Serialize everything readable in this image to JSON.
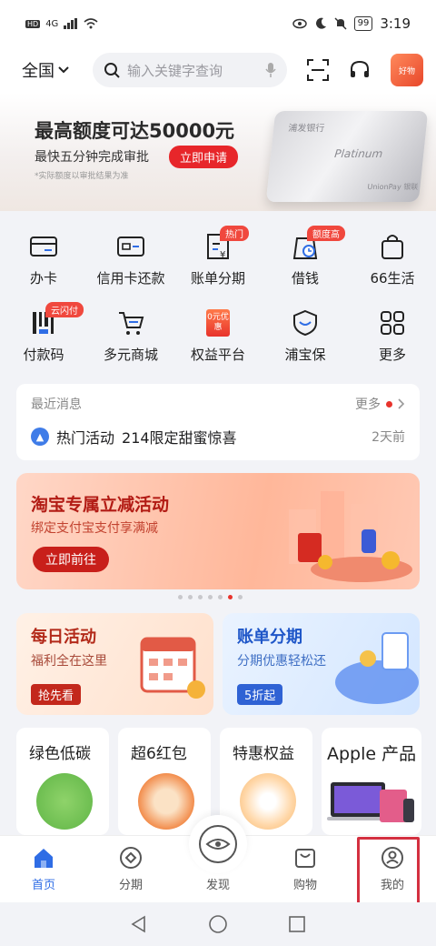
{
  "status_bar": {
    "network": "4G",
    "battery": "99",
    "time": "3:19"
  },
  "header": {
    "region": "全国",
    "search_placeholder": "输入关键字查询",
    "avatar_text": "好物"
  },
  "banner": {
    "title": "最高额度可达50000元",
    "subtitle": "最快五分钟完成审批",
    "button": "立即申请",
    "note": "*实际额度以审批结果为准",
    "card_bank": "浦发银行",
    "card_name": "Platinum",
    "card_logo": "UnionPay 银联"
  },
  "services": [
    {
      "label": "办卡",
      "icon": "card-icon",
      "tag": ""
    },
    {
      "label": "信用卡还款",
      "icon": "card-repay-icon",
      "tag": ""
    },
    {
      "label": "账单分期",
      "icon": "bill-installment-icon",
      "tag": "热门"
    },
    {
      "label": "借钱",
      "icon": "loan-icon",
      "tag": "额度高"
    },
    {
      "label": "66生活",
      "icon": "shopping-bag-icon",
      "tag": ""
    },
    {
      "label": "付款码",
      "icon": "qr-code-icon",
      "tag": "云闪付"
    },
    {
      "label": "多元商城",
      "icon": "cart-icon",
      "tag": ""
    },
    {
      "label": "权益平台",
      "icon": "benefit-icon",
      "tag": ""
    },
    {
      "label": "浦宝保",
      "icon": "shield-icon",
      "tag": ""
    },
    {
      "label": "更多",
      "icon": "grid-icon",
      "tag": ""
    }
  ],
  "benefit_icon_text": "0元优惠",
  "messages": {
    "title": "最近消息",
    "more": "更多",
    "item": {
      "category": "热门活动",
      "text": "214限定甜蜜惊喜",
      "time": "2天前"
    }
  },
  "promo": {
    "title": "淘宝专属立减活动",
    "subtitle": "绑定支付宝支付享满减",
    "button": "立即前往",
    "active_page": 6,
    "pages": 7
  },
  "cards": [
    {
      "title": "每日活动",
      "subtitle": "福利全在这里",
      "button": "抢先看"
    },
    {
      "title": "账单分期",
      "subtitle": "分期优惠轻松还",
      "button": "5折起"
    }
  ],
  "tiles": [
    {
      "title": "绿色低碳"
    },
    {
      "title": "超6红包"
    },
    {
      "title": "特惠权益"
    },
    {
      "title": "Apple 产品"
    }
  ],
  "tabbar": [
    {
      "label": "首页",
      "icon": "home-icon",
      "active": true
    },
    {
      "label": "分期",
      "icon": "installment-icon",
      "active": false
    },
    {
      "label": "发现",
      "icon": "eye-icon",
      "active": false
    },
    {
      "label": "购物",
      "icon": "shopping-bag-icon",
      "active": false
    },
    {
      "label": "我的",
      "icon": "user-icon",
      "active": false
    }
  ],
  "colors": {
    "accent": "#2f6de5",
    "red": "#e8332c",
    "highlight_box": "#d43040"
  }
}
